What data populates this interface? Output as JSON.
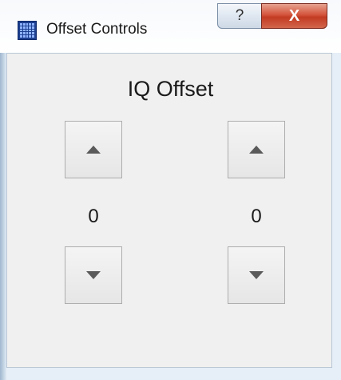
{
  "window": {
    "title": "Offset Controls",
    "help_label": "?",
    "close_label": "X"
  },
  "panel": {
    "heading": "IQ Offset",
    "left": {
      "value": "0"
    },
    "right": {
      "value": "0"
    }
  }
}
